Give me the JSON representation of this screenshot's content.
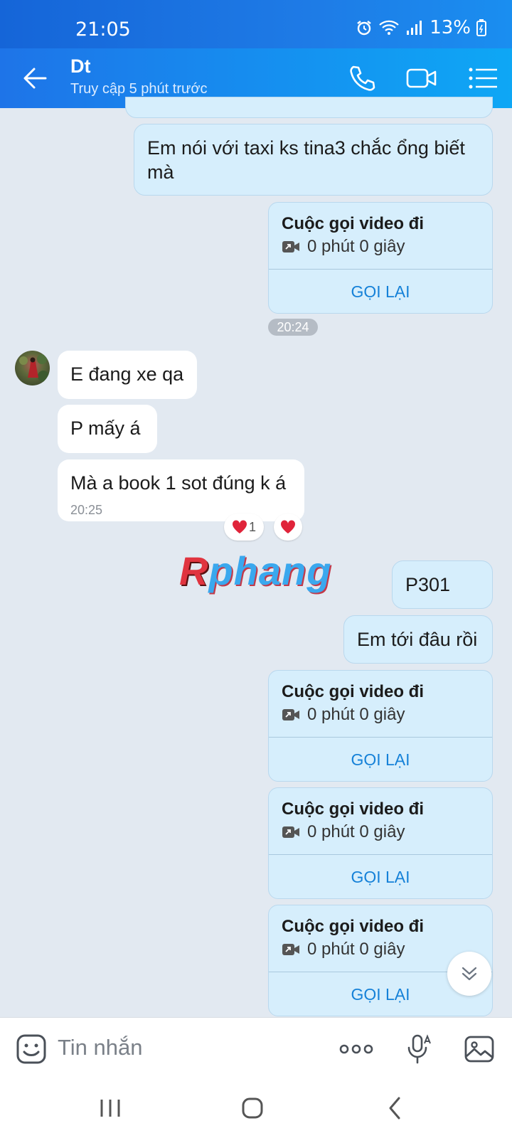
{
  "status_bar": {
    "time": "21:05",
    "battery": "13%"
  },
  "header": {
    "title": "Dt",
    "subtitle": "Truy cập 5 phút trước"
  },
  "messages": {
    "out_1": "Em nói với taxi ks tina3 chắc ổng biết mà",
    "time_pill": "20:24",
    "in_1": "E đang xe qa",
    "in_2": "P mấy á",
    "in_3": "Mà a book 1 sot đúng k á",
    "in_3_time": "20:25",
    "reaction_count": "1",
    "out_2": "P301",
    "out_3": "Em tới đâu rồi"
  },
  "calls": [
    {
      "title": "Cuộc gọi video đi",
      "duration": "0 phút 0 giây",
      "action": "GỌI LẠI"
    },
    {
      "title": "Cuộc gọi video đi",
      "duration": "0 phút 0 giây",
      "action": "GỌI LẠI"
    },
    {
      "title": "Cuộc gọi video đi",
      "duration": "0 phút 0 giây",
      "action": "GỌI LẠI"
    },
    {
      "title": "Cuộc gọi video đi",
      "duration": "0 phút 0 giây",
      "action": "GỌI LẠI"
    }
  ],
  "watermark": {
    "first": "R",
    "rest": "phang"
  },
  "input": {
    "placeholder": "Tin nhắn"
  },
  "icons": {
    "back": "arrow-left-icon",
    "call": "phone-icon",
    "video": "video-camera-icon",
    "menu": "list-icon",
    "emoji": "sticker-icon",
    "more": "more-dots-icon",
    "mic": "microphone-icon",
    "gallery": "image-icon",
    "scroll": "chevron-double-down-icon"
  },
  "colors": {
    "header": "#1590f0",
    "outgoing_bubble": "#d6eefc",
    "incoming_bubble": "#ffffff",
    "link": "#1581d8",
    "background": "#e2e9f1"
  }
}
